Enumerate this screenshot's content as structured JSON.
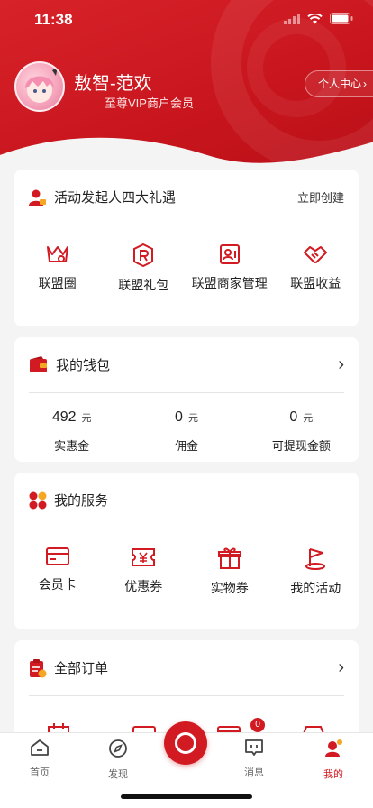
{
  "status": {
    "time": "11:38"
  },
  "profile": {
    "name": "敖智-范欢",
    "membership": "至尊VIP商户会员",
    "center_label": "个人中心"
  },
  "alliance": {
    "title": "活动发起人四大礼遇",
    "action": "立即创建",
    "items": [
      {
        "label": "联盟圈",
        "icon": "crown-icon"
      },
      {
        "label": "联盟礼包",
        "icon": "r-badge-icon"
      },
      {
        "label": "联盟商家管理",
        "icon": "merchant-card-icon"
      },
      {
        "label": "联盟收益",
        "icon": "handshake-icon"
      }
    ]
  },
  "wallet": {
    "title": "我的钱包",
    "unit": "元",
    "items": [
      {
        "value": "492",
        "label": "实惠金"
      },
      {
        "value": "0",
        "label": "佣金"
      },
      {
        "value": "0",
        "label": "可提现金额"
      }
    ]
  },
  "services": {
    "title": "我的服务",
    "items": [
      {
        "label": "会员卡",
        "icon": "card-icon"
      },
      {
        "label": "优惠券",
        "icon": "coupon-icon"
      },
      {
        "label": "实物券",
        "icon": "gift-icon"
      },
      {
        "label": "我的活动",
        "icon": "flag-icon"
      }
    ]
  },
  "orders": {
    "title": "全部订单",
    "badges": [
      "0"
    ]
  },
  "tabbar": {
    "items": [
      {
        "label": "首页"
      },
      {
        "label": "发现"
      },
      {
        "label": "消息"
      },
      {
        "label": "我的"
      }
    ],
    "active_color": "#d21a22"
  },
  "colors": {
    "brand_red": "#d21a22"
  }
}
